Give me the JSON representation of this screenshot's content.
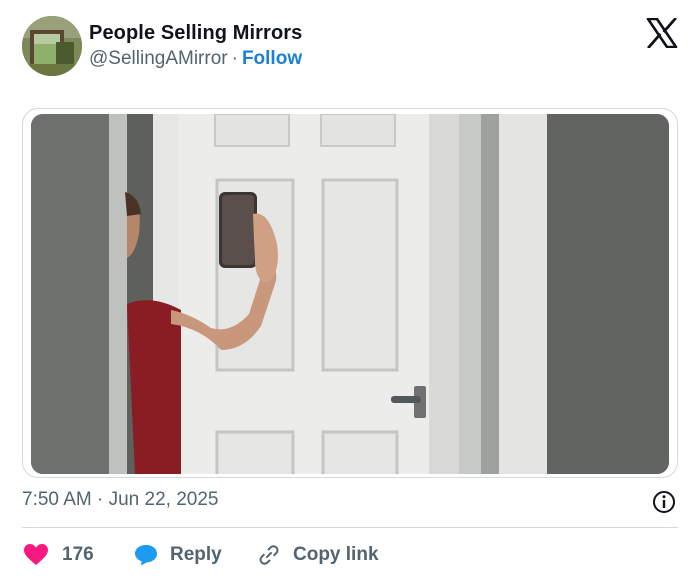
{
  "author": {
    "display_name": "People Selling Mirrors",
    "handle": "@SellingAMirror",
    "separator": "·",
    "follow_label": "Follow"
  },
  "media": {
    "kind": "photo"
  },
  "meta": {
    "timestamp": "7:50 AM · Jun 22, 2025"
  },
  "actions": {
    "like_count": "176",
    "reply_label": "Reply",
    "copy_link_label": "Copy link"
  },
  "colors": {
    "like": "#f91880",
    "reply": "#1d9bf0",
    "follow": "#1d7fd8",
    "secondary_text": "#536471"
  },
  "icons": [
    "x-logo-icon",
    "info-icon",
    "heart-icon",
    "reply-bubble-icon",
    "link-icon"
  ]
}
